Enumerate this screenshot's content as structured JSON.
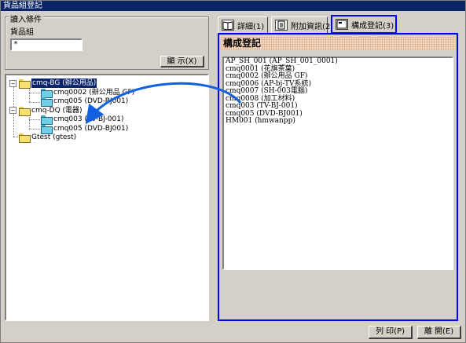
{
  "window": {
    "title": "貨品組登記"
  },
  "query": {
    "group_label": "讀入條件",
    "field_label": "貨品組",
    "field_value": "*",
    "show_button": "顯 示(X)"
  },
  "tree": [
    {
      "label": "cmq-BG (辦公用品)",
      "level": 0,
      "toggle": "−",
      "selected": true,
      "folder": "yellow"
    },
    {
      "label": "cmq0002 (辦公用品 GF)",
      "level": 1,
      "folder": "cyan"
    },
    {
      "label": "cmq005 (DVD-BJ001)",
      "level": 1,
      "folder": "cyan"
    },
    {
      "label": "cmq-DQ (電器)",
      "level": 0,
      "toggle": "−",
      "folder": "yellow"
    },
    {
      "label": "cmq003 (TV-BJ-001)",
      "level": 1,
      "folder": "cyan"
    },
    {
      "label": "cmq005 (DVD-BJ001)",
      "level": 1,
      "folder": "cyan"
    },
    {
      "label": "Gtest (gtest)",
      "level": 0,
      "folder": "yellow"
    }
  ],
  "tabs": [
    {
      "label": "詳細(1)",
      "icon": "book-icon",
      "active": false
    },
    {
      "label": "附加資訊(2)",
      "icon": "document-icon",
      "active": false
    },
    {
      "label": "構成登記(3)",
      "icon": "form-icon",
      "active": true
    }
  ],
  "detail": {
    "header": "構成登記",
    "lines": [
      "AP_SH_001 (AP_SH_001_0001)",
      "cmq0001 (花旗茶葉)",
      "cmq0002 (辦公用品 GF)",
      "cmq0006 (AP-bj-TV系統)",
      "cmq0007 (SH-003電腦)",
      "cmq0008 (加工材料)",
      "cmq003 (TV-BJ-001)",
      "cmq005 (DVD-BJ001)",
      "HM001 (hmwanpp)"
    ]
  },
  "footer": {
    "print_button": "列 印(P)",
    "close_button": "離 開(E)"
  },
  "colors": {
    "titlebar": "#0a246a",
    "highlight_box": "#0000ff",
    "arrow": "#1060e0",
    "header_bg": "#f0dcc4"
  }
}
